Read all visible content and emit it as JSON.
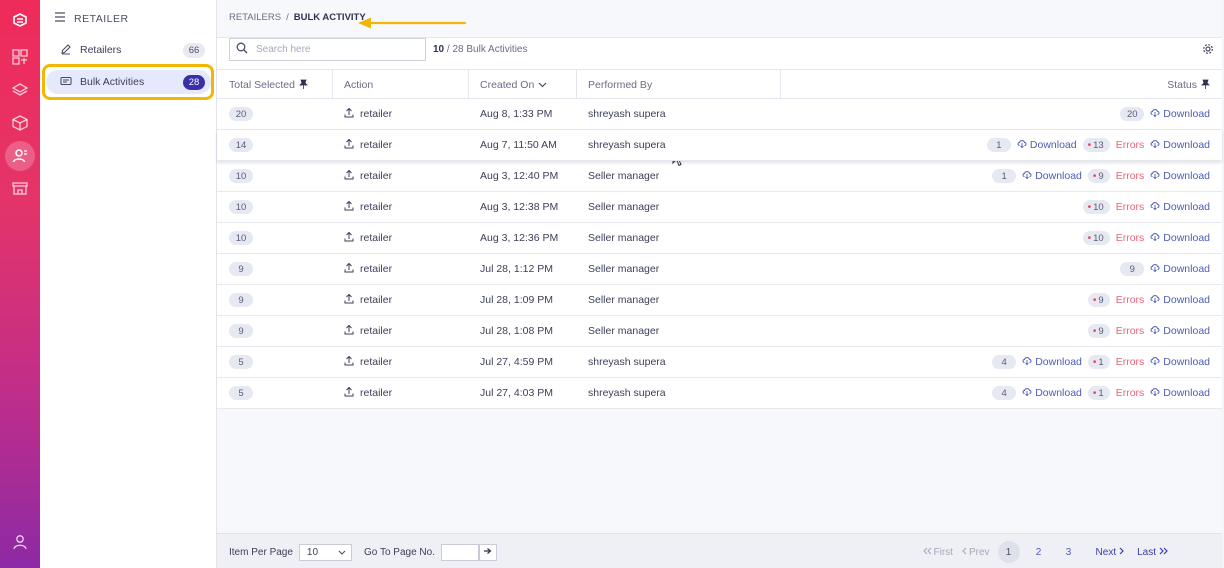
{
  "sidebar": {
    "heading": "RETAILER",
    "items": [
      {
        "label": "Retailers",
        "count": "66"
      },
      {
        "label": "Bulk Activities",
        "count": "28"
      }
    ]
  },
  "breadcrumb": {
    "parent": "RETAILERS",
    "separator": "/",
    "current": "BULK ACTIVITY"
  },
  "toolbar": {
    "search_placeholder": "Search here",
    "count_shown": "10",
    "count_rest": "/ 28 Bulk Activities"
  },
  "table": {
    "headers": {
      "total": "Total Selected",
      "action": "Action",
      "created": "Created On",
      "performed": "Performed By",
      "status": "Status"
    },
    "rows": [
      {
        "total": "20",
        "action": "retailer",
        "created": "Aug 8, 1:33 PM",
        "by": "shreyash supera",
        "success": "20",
        "errors": ""
      },
      {
        "total": "14",
        "action": "retailer",
        "created": "Aug 7, 11:50 AM",
        "by": "shreyash supera",
        "success": "1",
        "errors": "13"
      },
      {
        "total": "10",
        "action": "retailer",
        "created": "Aug 3, 12:40 PM",
        "by": "Seller manager",
        "success": "1",
        "errors": "9"
      },
      {
        "total": "10",
        "action": "retailer",
        "created": "Aug 3, 12:38 PM",
        "by": "Seller manager",
        "success": "",
        "errors": "10"
      },
      {
        "total": "10",
        "action": "retailer",
        "created": "Aug 3, 12:36 PM",
        "by": "Seller manager",
        "success": "",
        "errors": "10"
      },
      {
        "total": "9",
        "action": "retailer",
        "created": "Jul 28, 1:12 PM",
        "by": "Seller manager",
        "success": "9",
        "errors": ""
      },
      {
        "total": "9",
        "action": "retailer",
        "created": "Jul 28, 1:09 PM",
        "by": "Seller manager",
        "success": "",
        "errors": "9"
      },
      {
        "total": "9",
        "action": "retailer",
        "created": "Jul 28, 1:08 PM",
        "by": "Seller manager",
        "success": "",
        "errors": "9"
      },
      {
        "total": "5",
        "action": "retailer",
        "created": "Jul 27, 4:59 PM",
        "by": "shreyash supera",
        "success": "4",
        "errors": "1"
      },
      {
        "total": "5",
        "action": "retailer",
        "created": "Jul 27, 4:03 PM",
        "by": "shreyash supera",
        "success": "4",
        "errors": "1"
      }
    ],
    "download_label": "Download",
    "errors_label": "Errors"
  },
  "footer": {
    "per_page_label": "Item Per Page",
    "per_page_value": "10",
    "goto_label": "Go To Page No.",
    "first": "First",
    "prev": "Prev",
    "pages": [
      "1",
      "2",
      "3"
    ],
    "next": "Next",
    "last": "Last"
  },
  "colors": {
    "rail_top": "#ef2b5a",
    "rail_bottom": "#8d2aa5",
    "accent": "#3a2fa8",
    "link": "#4e5bb8",
    "error": "#e9657a",
    "highlight": "#f2b705"
  }
}
